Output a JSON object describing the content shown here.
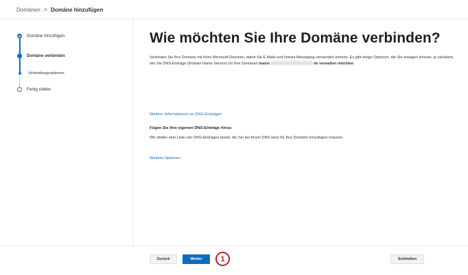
{
  "breadcrumb": {
    "parent": "Domänen",
    "separator": ">",
    "current": "Domäne hinzufügen"
  },
  "steps": [
    {
      "label": "Domäne hinzufügen",
      "state": "done"
    },
    {
      "label": "Domäne verbinden",
      "state": "active"
    },
    {
      "label": "Verbindungsoptionen",
      "state": "substep"
    },
    {
      "label": "Fertig stellen",
      "state": "pending"
    }
  ],
  "main": {
    "title": "Wie möchten Sie Ihre Domäne verbinden?",
    "intro": "Verbinden Sie Ihre Domäne mit Ihren Microsoft-Diensten, damit Sie E-Mails und Instant Messaging verwenden können. Es gibt einige Optionen, die Sie erwägen können, je nachdem, wie Sie DNS-Einträge (Domain Name Service) für Ihre Domänen",
    "domain_prefix": "teams",
    "domain_suffix": "de verwalten möchten",
    "intro_end": ".",
    "dns_link": "Weitere Informationen zu DNS-Einträgen",
    "option_title": "Fügen Sie Ihre eigenen DNS-Einträge hinzu",
    "option_desc": "Wir stellen eine Liste von DNS-Einträgen bereit, die Sie bei Ihrem DNS-Host für Ihre Domäne hinzufügen müssen.",
    "more_options": "Weitere Optionen"
  },
  "footer": {
    "back": "Zurück",
    "next": "Weiter",
    "close": "Schließen",
    "callout": "1"
  },
  "colors": {
    "accent": "#0f6cbd",
    "callout": "#a4262c"
  }
}
